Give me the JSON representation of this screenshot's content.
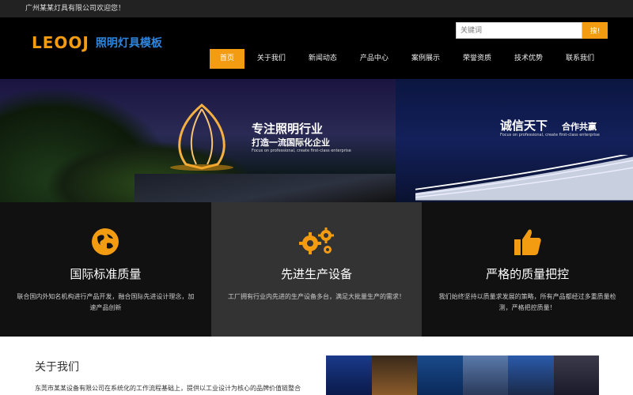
{
  "topbar": {
    "welcome": "广州某某灯具有限公司欢迎您！"
  },
  "header": {
    "logo_mark": "LEOOJ",
    "logo_sub": "照明灯具模板",
    "search_placeholder": "关键词",
    "search_button": "搜!"
  },
  "nav": {
    "items": [
      {
        "label": "首页",
        "active": true
      },
      {
        "label": "关于我们"
      },
      {
        "label": "新闻动态"
      },
      {
        "label": "产品中心"
      },
      {
        "label": "案例展示"
      },
      {
        "label": "荣誉资质"
      },
      {
        "label": "技术优势"
      },
      {
        "label": "联系我们"
      }
    ]
  },
  "banner": {
    "left_title": "专注照明行业",
    "left_subtitle": "打造一流国际化企业",
    "left_en": "Focus on professional, create first-class enterprise",
    "right_title": "诚信天下",
    "right_subtitle": "合作共赢",
    "right_en": "Focus on professional, create first-class enterprise"
  },
  "features": [
    {
      "icon": "globe-icon",
      "title": "国际标准质量",
      "desc": "联合国内外知名机构进行产品开发，融合国际先进设计理念，加速产品创新"
    },
    {
      "icon": "gears-icon",
      "title": "先进生产设备",
      "desc": "工厂拥有行业内先进的生产设备多台，满足大批量生产的需求！"
    },
    {
      "icon": "thumbs-up-icon",
      "title": "严格的质量把控",
      "desc": "我们始终坚持以质量求发展的策略，所有产品都经过多重质量检测，严格把控质量！"
    }
  ],
  "about": {
    "title": "关于我们",
    "text": "东莞市某某设备有限公司在系统化的工作流程基础上，提供以工业设计为核心的品牌价值链整合"
  },
  "colors": {
    "accent": "#f39c12",
    "logo_blue": "#2e86de"
  }
}
